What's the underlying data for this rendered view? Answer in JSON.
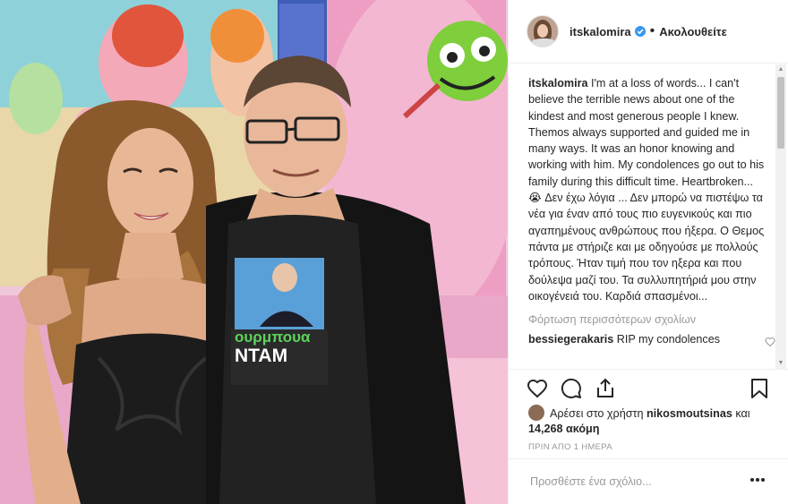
{
  "post": {
    "username": "itskalomira",
    "follow_label": "Ακολουθείτε",
    "separator": "•",
    "caption_user": "itskalomira",
    "caption_text": "I'm at a loss of words... I can't believe the terrible news about one of the kindest and most generous people I knew. Themos always supported and guided me in many ways. It was an honor knowing and working with him. My condolences go out to his family during this difficult time. Heartbroken...😭 Δεν έχω λόγια ... Δεν μπορώ να πιστέψω τα νέα για έναν από τους πιο ευγενικούς και πιο αγαπημένους ανθρώπους που ήξερα. Ο Θεμος πάντα με στήριζε και με οδηγούσε με πολλούς τρόπους. Ήταν τιμή που τον ηξερα και που δούλεψα μαζί του. Τα συλλυπητήριά μου στην οικογένειά του. Καρδιά σπασμένοι...",
    "load_more": "Φόρτωση περισσότερων σχολίων",
    "comment_user": "bessiegerakaris",
    "comment_text": "RIP my condolences",
    "likes_prefix": "Αρέσει στο χρήστη",
    "likes_user": "nikosmoutsinas",
    "likes_mid": "και",
    "likes_count": "14,268 ακόμη",
    "timestamp": "ΠΡΙΝ ΑΠΟ 1 ΗΜΕΡΑ",
    "add_comment_placeholder": "Προσθέστε ένα σχόλιο...",
    "shirt_text_top": "ουρμπουα",
    "shirt_text_bottom": "ΝΤΑΜ"
  },
  "colors": {
    "verified": "#3897f0",
    "text": "#262626",
    "muted": "#999999",
    "border": "#efefef"
  },
  "icons": {
    "verified": "verified-badge-icon",
    "like": "heart-icon",
    "comment": "comment-bubble-icon",
    "share": "share-icon",
    "save": "bookmark-icon",
    "more": "ellipsis-icon"
  }
}
